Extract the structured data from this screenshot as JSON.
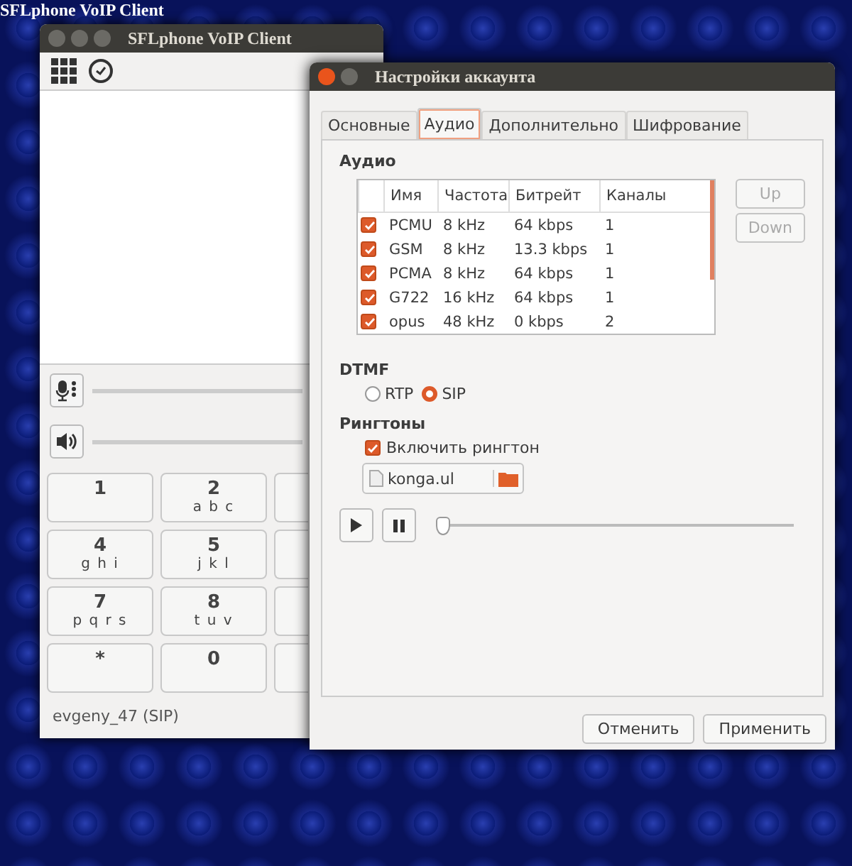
{
  "desktop_title": "SFLphone VoIP Client",
  "main_window": {
    "title": "SFLphone VoIP Client",
    "keypad": [
      [
        {
          "kind": "key",
          "digit": "1"
        },
        {
          "kind": "key",
          "digit": "2",
          "letters": "a b c"
        },
        {
          "kind": "hidden"
        }
      ],
      [
        {
          "kind": "key",
          "digit": "4",
          "letters": "g h i"
        },
        {
          "kind": "key",
          "digit": "5",
          "letters": "j k l"
        },
        {
          "kind": "hidden"
        }
      ],
      [
        {
          "kind": "key",
          "digit": "7",
          "letters": "p q r s"
        },
        {
          "kind": "key",
          "digit": "8",
          "letters": "t u v"
        },
        {
          "kind": "hidden"
        }
      ],
      [
        {
          "kind": "key",
          "digit": "*"
        },
        {
          "kind": "key",
          "digit": "0"
        },
        {
          "kind": "hidden"
        }
      ]
    ],
    "status": "evgeny_47 (SIP)"
  },
  "dialog": {
    "title": "Настройки аккаунта",
    "tabs": [
      {
        "label": "Основные",
        "selected": false
      },
      {
        "label": "Аудио",
        "selected": true
      },
      {
        "label": "Дополнительно",
        "selected": false
      },
      {
        "label": "Шифрование",
        "selected": false
      }
    ],
    "audio_heading": "Аудио",
    "codecs": {
      "columns": [
        "Имя",
        "Частота",
        "Битрейт",
        "Каналы"
      ],
      "rows": [
        {
          "checked": true,
          "cells": [
            "PCMU",
            "8 kHz",
            "64 kbps",
            "1"
          ]
        },
        {
          "checked": true,
          "cells": [
            "GSM",
            "8 kHz",
            "13.3 kbps",
            "1"
          ]
        },
        {
          "checked": true,
          "cells": [
            "PCMA",
            "8 kHz",
            "64 kbps",
            "1"
          ]
        },
        {
          "checked": true,
          "cells": [
            "G722",
            "16 kHz",
            "64 kbps",
            "1"
          ]
        },
        {
          "checked": true,
          "cells": [
            "opus",
            "48 kHz",
            "0 kbps",
            "2"
          ]
        }
      ]
    },
    "order_buttons": [
      {
        "label": "Up",
        "disabled": true
      },
      {
        "label": "Down",
        "disabled": true
      }
    ],
    "dtmf": {
      "heading": "DTMF",
      "options": [
        {
          "label": "RTP",
          "selected": false
        },
        {
          "label": "SIP",
          "selected": true
        }
      ]
    },
    "ringtones": {
      "heading": "Рингтоны",
      "enable": {
        "label": "Включить рингтон",
        "checked": true
      },
      "file": "konga.ul",
      "level": 0
    },
    "buttons": [
      "Отменить",
      "Применить"
    ]
  }
}
